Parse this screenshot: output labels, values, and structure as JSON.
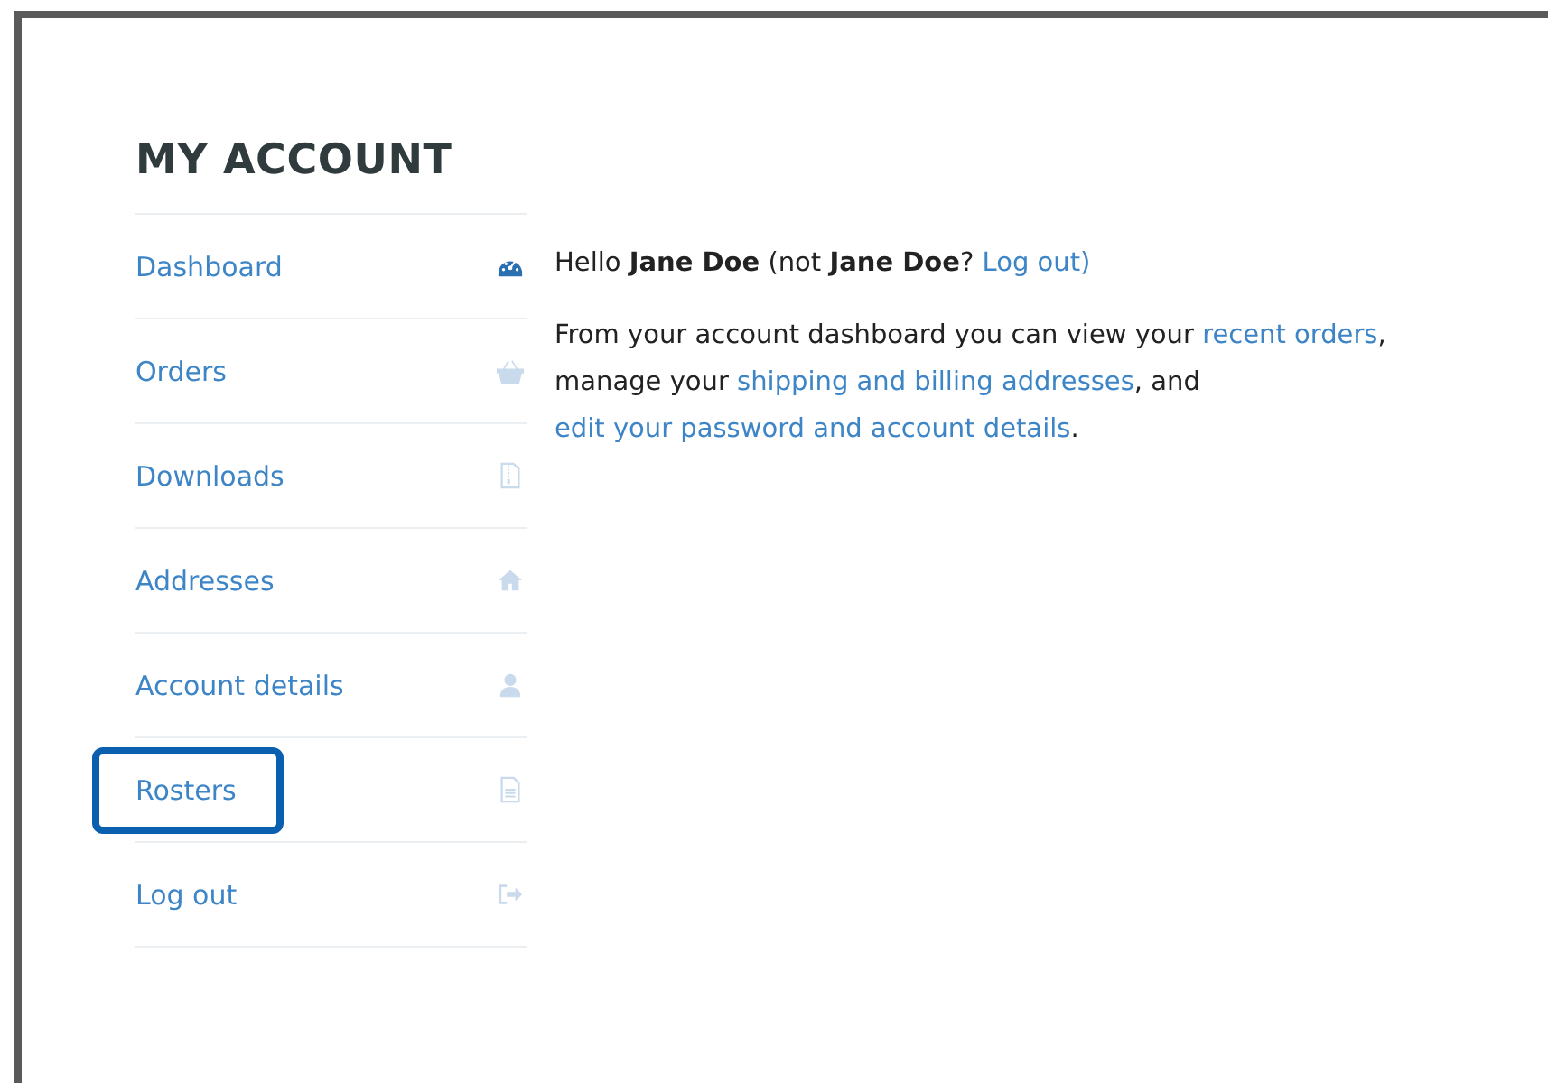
{
  "title": "MY ACCOUNT",
  "nav": [
    {
      "label": "Dashboard",
      "kind": "dashboard",
      "selected": true,
      "highlighted": false
    },
    {
      "label": "Orders",
      "kind": "basket",
      "selected": false,
      "highlighted": false
    },
    {
      "label": "Downloads",
      "kind": "file-zip",
      "selected": false,
      "highlighted": false
    },
    {
      "label": "Addresses",
      "kind": "home",
      "selected": false,
      "highlighted": false
    },
    {
      "label": "Account details",
      "kind": "user",
      "selected": false,
      "highlighted": false
    },
    {
      "label": "Rosters",
      "kind": "file",
      "selected": false,
      "highlighted": true
    },
    {
      "label": "Log out",
      "kind": "logout",
      "selected": false,
      "highlighted": false
    }
  ],
  "greeting": [
    {
      "kind": "text",
      "text": "Hello "
    },
    {
      "kind": "bold",
      "text": "Jane Doe"
    },
    {
      "kind": "text",
      "text": " (not  "
    },
    {
      "kind": "bold",
      "text": "Jane Doe"
    },
    {
      "kind": "text",
      "text": "? "
    },
    {
      "kind": "link",
      "text": "Log out)"
    }
  ],
  "intro": [
    {
      "kind": "text",
      "text": "From your account dashboard you can view your "
    },
    {
      "kind": "link",
      "text": "recent orders"
    },
    {
      "kind": "text",
      "text": ", manage your "
    },
    {
      "kind": "link",
      "text": "shipping and billing addresses"
    },
    {
      "kind": "text",
      "text": ", and "
    },
    {
      "kind": "link",
      "text": "edit your password and account details"
    },
    {
      "kind": "text",
      "text": "."
    }
  ]
}
